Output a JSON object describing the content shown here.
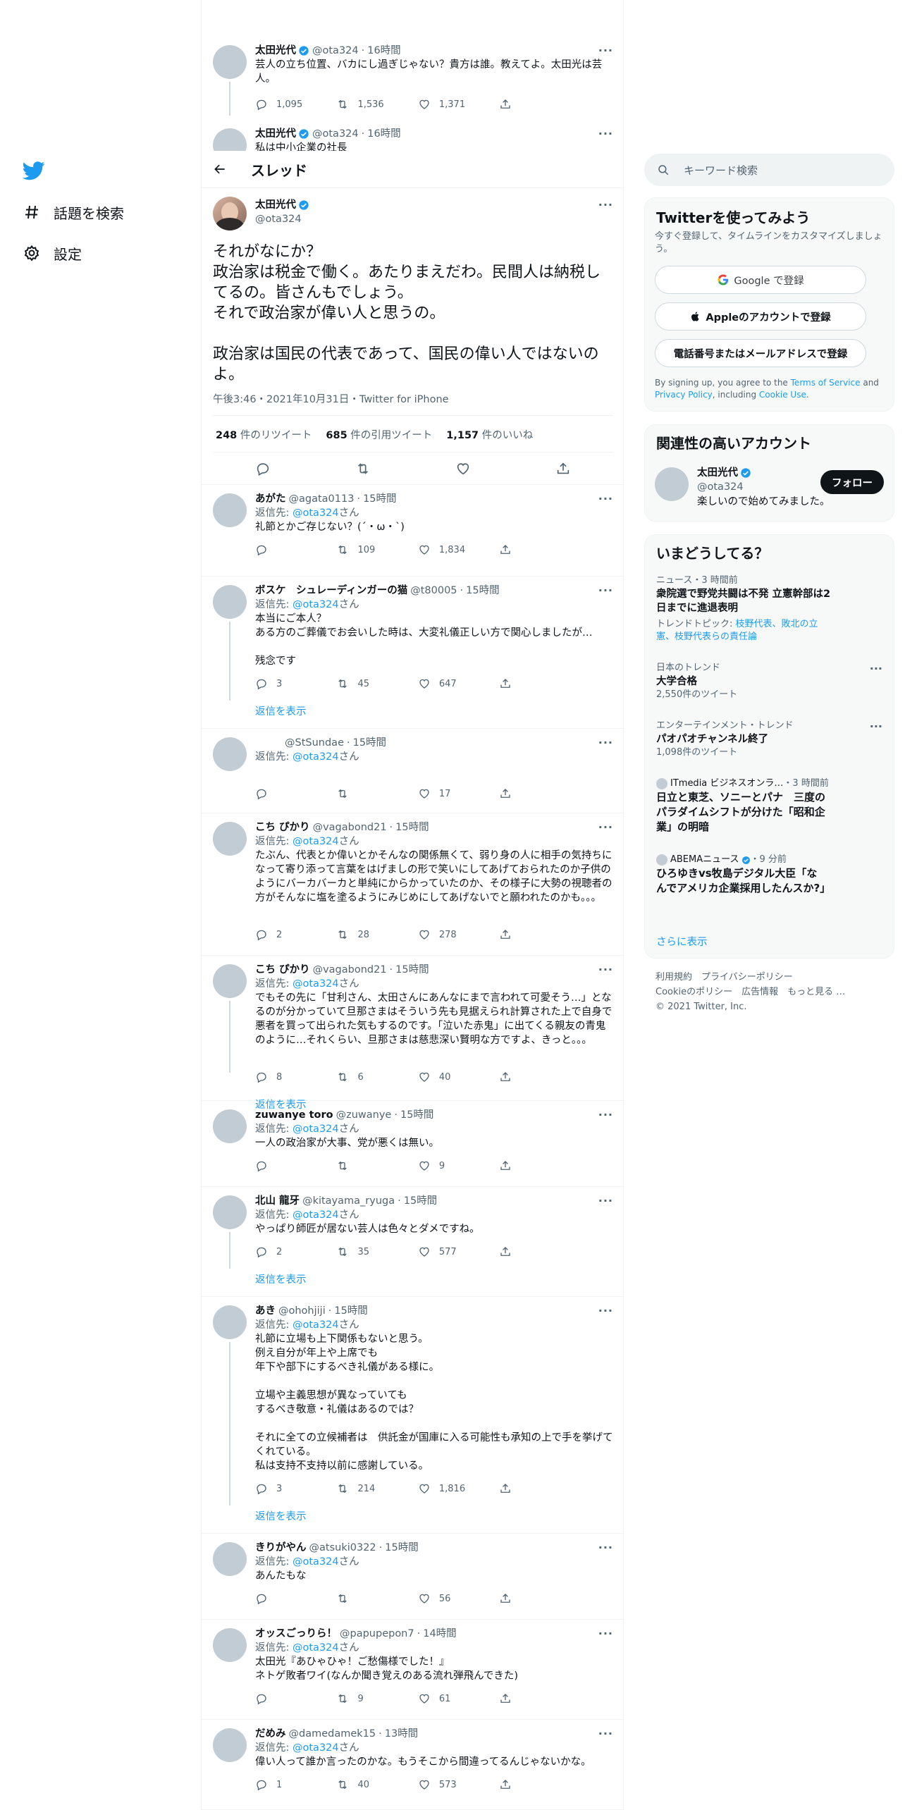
{
  "nav": {
    "explore": "話題を検索",
    "settings": "設定"
  },
  "header": {
    "title": "スレッド"
  },
  "above_tweet": {
    "name": "太田光代",
    "handle": "@ota324",
    "time": "16時間",
    "text": "芸人の立ち位置、バカにし過ぎじゃない？貴方は誰。教えてよ。太田光は芸人。",
    "replies": "1,095",
    "retweets": "1,536",
    "likes": "1,371"
  },
  "above_tweet2": {
    "name": "太田光代",
    "handle": "@ota324",
    "time": "16時間",
    "text": "私は中小企業の社長"
  },
  "main_tweet": {
    "name": "太田光代",
    "handle": "@ota324",
    "text": "それがなにか？\n政治家は税金で働く。あたりまえだわ。民間人は納税してるの。皆さんもでしょう。\nそれで政治家が偉い人と思うの。\n\n政治家は国民の代表であって、国民の偉い人ではないのよ。",
    "meta": "午後3:46・2021年10月31日・Twitter for iPhone",
    "retweets_num": "248",
    "retweets_label": "件のリツイート",
    "quotes_num": "685",
    "quotes_label": "件の引用ツイート",
    "likes_num": "1,157",
    "likes_label": "件のいいね"
  },
  "reply_label": "返信先:",
  "reply_target": "@ota324",
  "reply_suffix": "さん",
  "show_replies": "返信を表示",
  "replies": [
    {
      "name": "あがた",
      "handle": "@agata0113",
      "time": "15時間",
      "text": "礼節とかご存じない？(´・ω・`)",
      "r": "",
      "rt": "109",
      "l": "1,834"
    },
    {
      "name": "ボスケ　シュレーディンガーの猫",
      "handle": "@t80005",
      "time": "15時間",
      "text": "本当にご本人？\nある方のご葬儀でお会いした時は、大変礼儀正しい方で関心しましたが…\n\n残念です",
      "r": "3",
      "rt": "45",
      "l": "647"
    },
    {
      "name": "",
      "handle": "@StSundae",
      "time": "15時間",
      "text": "",
      "r": "",
      "rt": "",
      "l": "17"
    },
    {
      "name": "こち ぴかり",
      "handle": "@vagabond21",
      "time": "15時間",
      "text": "たぶん、代表とか偉いとかそんなの関係無くて、弱り身の人に相手の気持ちになって寄り添って言葉をはげましの形で笑いにしてあげておられたのか子供のようにバーカバーカと単純にからかっていたのか、その様子に大勢の視聴者の方がそんなに塩を塗るようにみじめにしてあげないでと願われたのかも。。。",
      "r": "2",
      "rt": "28",
      "l": "278"
    },
    {
      "name": "こち ぴかり",
      "handle": "@vagabond21",
      "time": "15時間",
      "text": "でもその先に「甘利さん、太田さんにあんなにまで言われて可愛そう…」となるのが分かっていて旦那さまはそういう先も見据えられ計算された上で自身で悪者を買って出られた気もするのです。「泣いた赤鬼」に出てくる親友の青鬼のように…それくらい、旦那さまは慈悲深い賢明な方ですよ、きっと。。。",
      "r": "8",
      "rt": "6",
      "l": "40"
    },
    {
      "name": "zuwanye toro",
      "handle": "@zuwanye",
      "time": "15時間",
      "text": "一人の政治家が大事、党が悪くは無い。",
      "r": "",
      "rt": "",
      "l": "9"
    },
    {
      "name": "北山 龍牙",
      "handle": "@kitayama_ryuga",
      "time": "15時間",
      "text": "やっぱり師匠が居ない芸人は色々とダメですね。",
      "r": "2",
      "rt": "35",
      "l": "577"
    },
    {
      "name": "あき",
      "handle": "@ohohjiji",
      "time": "15時間",
      "text": "礼節に立場も上下関係もないと思う。\n例え自分が年上や上席でも\n年下や部下にするべき礼儀がある様に。\n\n立場や主義思想が異なっていても\nするべき敬意・礼儀はあるのでは？\n\nそれに全ての立候補者は　供託金が国庫に入る可能性も承知の上で手を挙げてくれている。\n私は支持不支持以前に感謝している。",
      "r": "3",
      "rt": "214",
      "l": "1,816"
    },
    {
      "name": "きりがやん",
      "handle": "@atsuki0322",
      "time": "15時間",
      "text": "あんたもな",
      "r": "",
      "rt": "",
      "l": "56"
    },
    {
      "name": "オッスごっりら！",
      "handle": "@papupepon7",
      "time": "14時間",
      "text": "太田光『あひゃひゃ！ご愁傷様でした！』\nネトゲ敗者ワイ(なんか聞き覚えのある流れ弾飛んできた)",
      "r": "",
      "rt": "9",
      "l": "61"
    },
    {
      "name": "だめみ",
      "handle": "@damedamek15",
      "time": "13時間",
      "text": "偉い人って誰か言ったのかな。もうそこから間違ってるんじゃないかな。",
      "r": "1",
      "rt": "40",
      "l": "573"
    }
  ],
  "search": {
    "placeholder": "キーワード検索"
  },
  "signup": {
    "title": "Twitterを使ってみよう",
    "sub": "今すぐ登録して、タイムラインをカスタマイズしましょう。",
    "google": "Google で登録",
    "apple": "Appleのアカウントで登録",
    "phone": "電話番号またはメールアドレスで登録",
    "legal_1": "By signing up, you agree to the ",
    "legal_tos": "Terms of Service",
    "legal_2": " and ",
    "legal_pp": "Privacy Policy",
    "legal_3": ", including ",
    "legal_cu": "Cookie Use",
    "legal_4": "."
  },
  "related": {
    "title": "関連性の高いアカウント",
    "name": "太田光代",
    "handle": "@ota324",
    "bio": "楽しいので始めてみました。",
    "follow": "フォロー"
  },
  "trends": {
    "title": "いまどうしてる？",
    "items": [
      {
        "meta": "ニュース・3 時間前",
        "title": "衆院選で野党共闘は不発 立憲幹部は2日までに進退表明",
        "sub_label": "トレンドトピック:",
        "sub_links": "枝野代表、敗北の立憲、枝野代表らの責任論"
      },
      {
        "meta": "日本のトレンド",
        "title": "大学合格",
        "count": "2,550件のツイート"
      },
      {
        "meta": "エンターテインメント・トレンド",
        "title": "パオパオチャンネル終了",
        "count": "1,098件のツイート"
      },
      {
        "source": "ITmedia ビジネスオンラ…",
        "time": "3 時間前",
        "title": "日立と東芝、ソニーとパナ　三度のパラダイムシフトが分けた「昭和企業」の明暗"
      },
      {
        "source": "ABEMAニュース",
        "time": "9 分前",
        "title": "ひろゆきvs牧島デジタル大臣「なんでアメリカ企業採用したんスか?」"
      }
    ],
    "more": "さらに表示"
  },
  "footer": {
    "terms": "利用規約",
    "privacy": "プライバシーポリシー",
    "cookie": "Cookieのポリシー",
    "ads": "広告情報",
    "more": "もっと見る …",
    "copyright": "© 2021 Twitter, Inc."
  },
  "colors": {
    "accent": "#1d9bf0",
    "text": "#0f1419",
    "secondary": "#536471",
    "border": "#eff3f4"
  }
}
